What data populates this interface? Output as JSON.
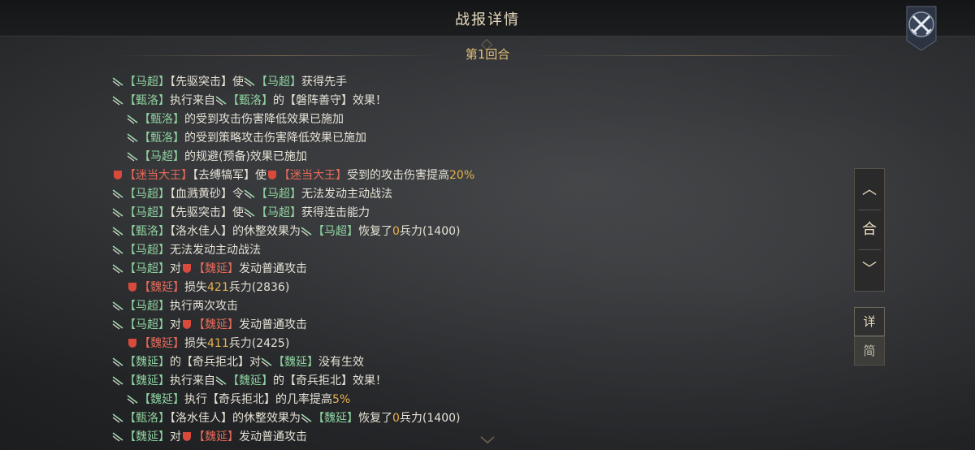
{
  "header": {
    "title": "战报详情"
  },
  "round": {
    "label": "第1回合"
  },
  "side_panel": {
    "up": "︿",
    "merge": "合",
    "down": "﹀"
  },
  "toggle": {
    "detail": "详",
    "brief": "简"
  },
  "log": [
    {
      "indent": false,
      "segs": [
        {
          "i": "g"
        },
        {
          "t": "【马超】",
          "c": "g"
        },
        {
          "t": "【先驱突击】",
          "c": "n"
        },
        {
          "t": "使",
          "c": "n"
        },
        {
          "i": "g"
        },
        {
          "t": "【马超】",
          "c": "g"
        },
        {
          "t": "获得先手",
          "c": "n"
        }
      ]
    },
    {
      "indent": false,
      "segs": [
        {
          "i": "g"
        },
        {
          "t": "【甄洛】",
          "c": "g"
        },
        {
          "t": "执行来自",
          "c": "n"
        },
        {
          "i": "g"
        },
        {
          "t": "【甄洛】",
          "c": "g"
        },
        {
          "t": "的【磐阵善守】效果！",
          "c": "n"
        }
      ]
    },
    {
      "indent": true,
      "segs": [
        {
          "i": "g"
        },
        {
          "t": "【甄洛】",
          "c": "g"
        },
        {
          "t": "的受到攻击伤害降低效果已施加",
          "c": "n"
        }
      ]
    },
    {
      "indent": true,
      "segs": [
        {
          "i": "g"
        },
        {
          "t": "【甄洛】",
          "c": "g"
        },
        {
          "t": "的受到策略攻击伤害降低效果已施加",
          "c": "n"
        }
      ]
    },
    {
      "indent": true,
      "segs": [
        {
          "i": "g"
        },
        {
          "t": "【马超】",
          "c": "g"
        },
        {
          "t": "的规避(预备)效果已施加",
          "c": "n"
        }
      ]
    },
    {
      "indent": false,
      "segs": [
        {
          "i": "r"
        },
        {
          "t": "【迷当大王】",
          "c": "r"
        },
        {
          "t": "【去缚犒军】",
          "c": "n"
        },
        {
          "t": "使",
          "c": "n"
        },
        {
          "i": "r"
        },
        {
          "t": "【迷当大王】",
          "c": "r"
        },
        {
          "t": "受到的攻击伤害提高",
          "c": "n"
        },
        {
          "t": "20%",
          "c": "o"
        }
      ]
    },
    {
      "indent": false,
      "segs": [
        {
          "i": "g"
        },
        {
          "t": "【马超】",
          "c": "g"
        },
        {
          "t": "【血溅黄砂】",
          "c": "n"
        },
        {
          "t": "令",
          "c": "n"
        },
        {
          "i": "g"
        },
        {
          "t": "【马超】",
          "c": "g"
        },
        {
          "t": "无法发动主动战法",
          "c": "n"
        }
      ]
    },
    {
      "indent": false,
      "segs": [
        {
          "i": "g"
        },
        {
          "t": "【马超】",
          "c": "g"
        },
        {
          "t": "【先驱突击】",
          "c": "n"
        },
        {
          "t": "使",
          "c": "n"
        },
        {
          "i": "g"
        },
        {
          "t": "【马超】",
          "c": "g"
        },
        {
          "t": "获得连击能力",
          "c": "n"
        }
      ]
    },
    {
      "indent": false,
      "segs": [
        {
          "i": "g"
        },
        {
          "t": "【甄洛】",
          "c": "g"
        },
        {
          "t": "【洛水佳人】",
          "c": "n"
        },
        {
          "t": "的休整效果为",
          "c": "n"
        },
        {
          "i": "g"
        },
        {
          "t": "【马超】",
          "c": "g"
        },
        {
          "t": "恢复了",
          "c": "n"
        },
        {
          "t": "0",
          "c": "o"
        },
        {
          "t": "兵力(1400)",
          "c": "n"
        }
      ]
    },
    {
      "indent": false,
      "segs": [
        {
          "i": "g"
        },
        {
          "t": "【马超】",
          "c": "g"
        },
        {
          "t": "无法发动主动战法",
          "c": "n"
        }
      ]
    },
    {
      "indent": false,
      "segs": [
        {
          "i": "g"
        },
        {
          "t": "【马超】",
          "c": "g"
        },
        {
          "t": "对",
          "c": "n"
        },
        {
          "i": "r"
        },
        {
          "t": "【魏延】",
          "c": "r"
        },
        {
          "t": "发动普通攻击",
          "c": "n"
        }
      ]
    },
    {
      "indent": true,
      "segs": [
        {
          "i": "r"
        },
        {
          "t": "【魏延】",
          "c": "r"
        },
        {
          "t": "损失",
          "c": "n"
        },
        {
          "t": "421",
          "c": "o"
        },
        {
          "t": "兵力(2836)",
          "c": "n"
        }
      ]
    },
    {
      "indent": false,
      "segs": [
        {
          "i": "g"
        },
        {
          "t": "【马超】",
          "c": "g"
        },
        {
          "t": "执行两次攻击",
          "c": "n"
        }
      ]
    },
    {
      "indent": false,
      "segs": [
        {
          "i": "g"
        },
        {
          "t": "【马超】",
          "c": "g"
        },
        {
          "t": "对",
          "c": "n"
        },
        {
          "i": "r"
        },
        {
          "t": "【魏延】",
          "c": "r"
        },
        {
          "t": "发动普通攻击",
          "c": "n"
        }
      ]
    },
    {
      "indent": true,
      "segs": [
        {
          "i": "r"
        },
        {
          "t": "【魏延】",
          "c": "r"
        },
        {
          "t": "损失",
          "c": "n"
        },
        {
          "t": "411",
          "c": "o"
        },
        {
          "t": "兵力(2425)",
          "c": "n"
        }
      ]
    },
    {
      "indent": false,
      "segs": [
        {
          "i": "g"
        },
        {
          "t": "【魏延】",
          "c": "g"
        },
        {
          "t": "的【奇兵拒北】对",
          "c": "n"
        },
        {
          "i": "g"
        },
        {
          "t": "【魏延】",
          "c": "g"
        },
        {
          "t": "没有生效",
          "c": "n"
        }
      ]
    },
    {
      "indent": false,
      "segs": [
        {
          "i": "g"
        },
        {
          "t": "【魏延】",
          "c": "g"
        },
        {
          "t": "执行来自",
          "c": "n"
        },
        {
          "i": "g"
        },
        {
          "t": "【魏延】",
          "c": "g"
        },
        {
          "t": "的【奇兵拒北】效果！",
          "c": "n"
        }
      ]
    },
    {
      "indent": true,
      "segs": [
        {
          "i": "g"
        },
        {
          "t": "【魏延】",
          "c": "g"
        },
        {
          "t": "执行【奇兵拒北】的几率提高",
          "c": "n"
        },
        {
          "t": "5%",
          "c": "o"
        }
      ]
    },
    {
      "indent": false,
      "segs": [
        {
          "i": "g"
        },
        {
          "t": "【甄洛】",
          "c": "g"
        },
        {
          "t": "【洛水佳人】",
          "c": "n"
        },
        {
          "t": "的休整效果为",
          "c": "n"
        },
        {
          "i": "g"
        },
        {
          "t": "【魏延】",
          "c": "g"
        },
        {
          "t": "恢复了",
          "c": "n"
        },
        {
          "t": "0",
          "c": "o"
        },
        {
          "t": "兵力(1400)",
          "c": "n"
        }
      ]
    },
    {
      "indent": false,
      "segs": [
        {
          "i": "g"
        },
        {
          "t": "【魏延】",
          "c": "g"
        },
        {
          "t": "对",
          "c": "n"
        },
        {
          "i": "r"
        },
        {
          "t": "【魏延】",
          "c": "r"
        },
        {
          "t": "发动普通攻击",
          "c": "n"
        }
      ]
    }
  ]
}
